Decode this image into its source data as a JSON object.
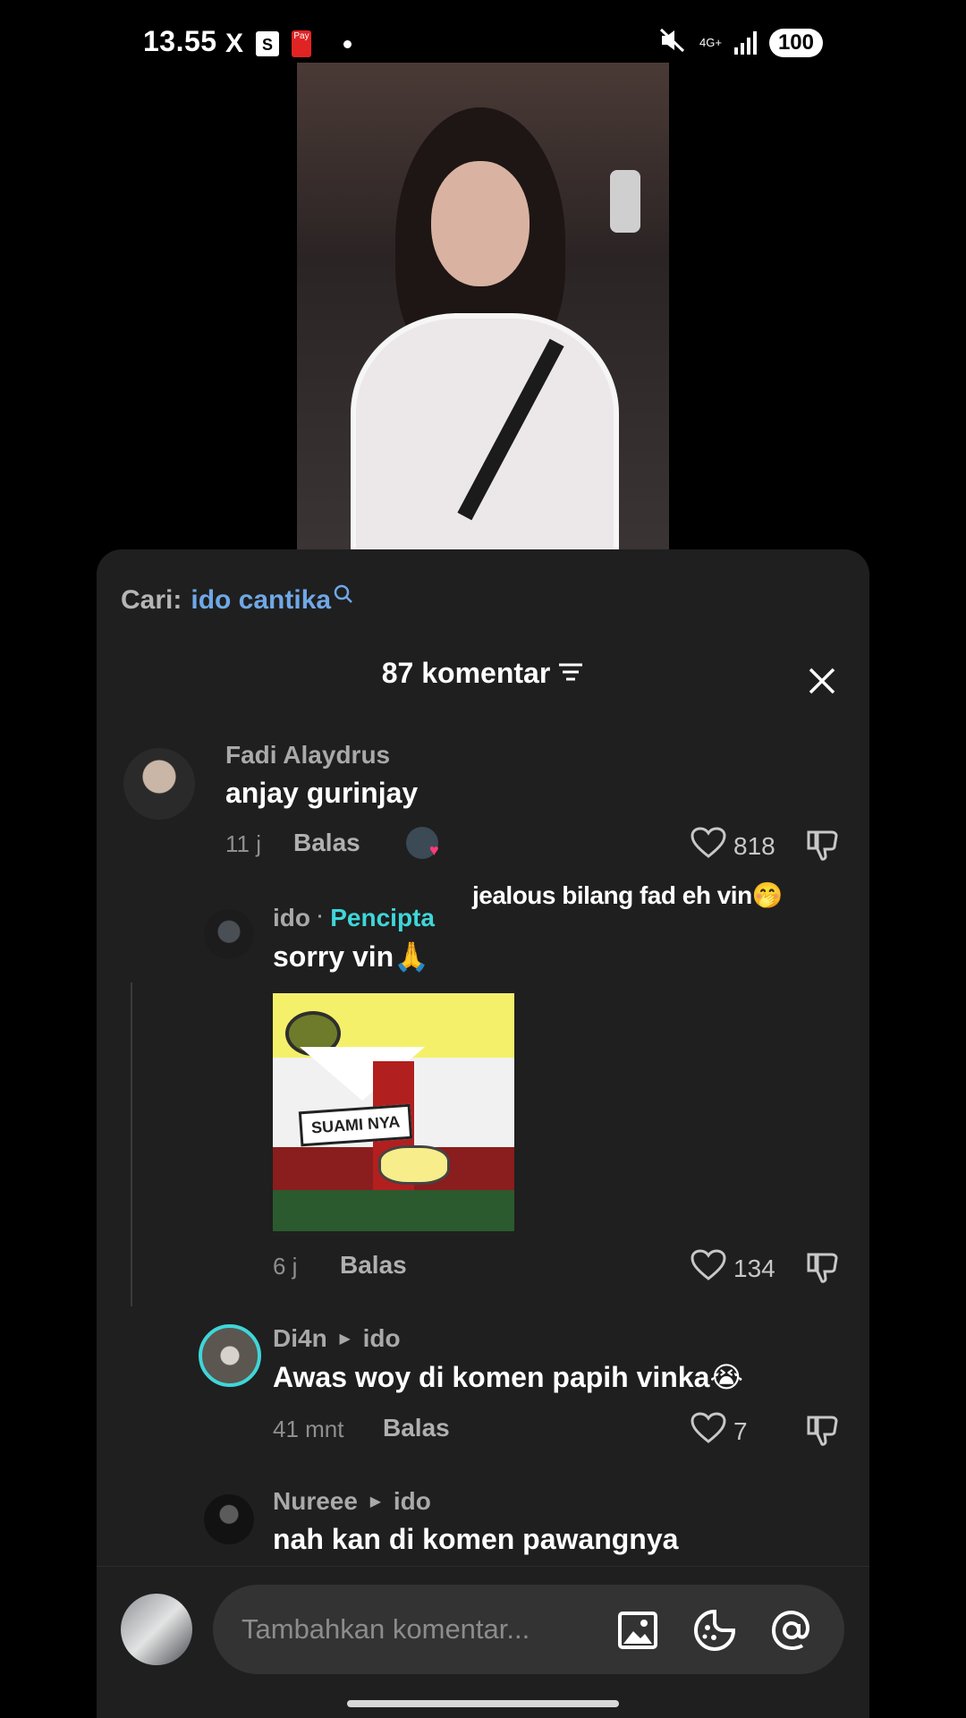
{
  "status_bar": {
    "time": "13.55",
    "x_icon_glyph": "X",
    "shop_icon_glyph": "S",
    "pay_icon_glyph": "Pay",
    "network": "4G+",
    "battery": "100"
  },
  "search": {
    "prefix": "Cari:",
    "query": "ido cantika"
  },
  "header": {
    "title": "87 komentar"
  },
  "overlay_text": "jealous bilang fad eh vin🤭",
  "comments": [
    {
      "user": "Fadi Alaydrus",
      "text": "anjay gurinjay",
      "time": "11 j",
      "reply_label": "Balas",
      "likes": "818"
    },
    {
      "user": "ido",
      "separator": "·",
      "badge": "Pencipta",
      "text": "sorry vin🙏",
      "meme_tag": "SUAMI NYA",
      "time": "6 j",
      "reply_label": "Balas",
      "likes": "134"
    },
    {
      "user": "Di4n",
      "reply_to": "ido",
      "text": "Awas woy di komen papih vinka😭",
      "time": "41 mnt",
      "reply_label": "Balas",
      "likes": "7"
    },
    {
      "user": "Nureee",
      "reply_to": "ido",
      "text": "nah kan di komen pawangnya"
    }
  ],
  "input": {
    "placeholder": "Tambahkan komentar..."
  },
  "colors": {
    "sheet_bg": "#1f1f1f",
    "search_query": "#6fa8e6",
    "creator_badge": "#3fd6d9",
    "ring": "#3fd6d9"
  },
  "icons": [
    "search-icon",
    "filter-icon",
    "close-icon",
    "heart-icon",
    "dislike-icon",
    "image-icon",
    "emoji-icon",
    "mention-icon"
  ]
}
